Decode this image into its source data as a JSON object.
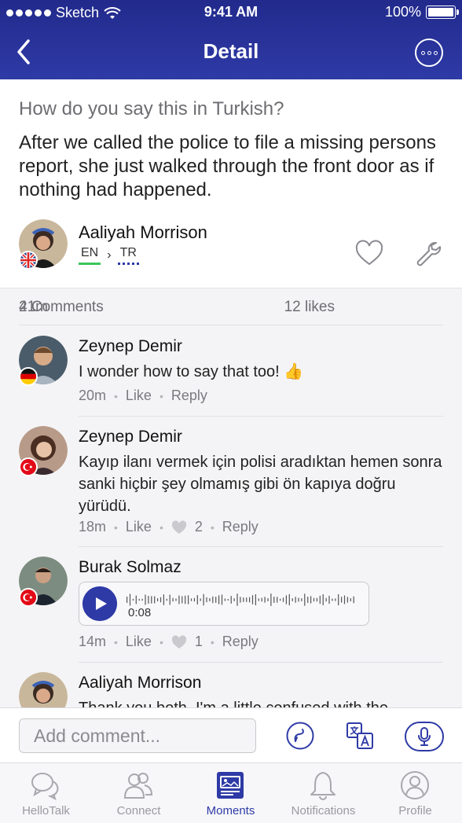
{
  "status_bar": {
    "carrier": "Sketch",
    "time": "9:41 AM",
    "battery": "100%"
  },
  "nav": {
    "title": "Detail"
  },
  "post": {
    "question": "How do you say this in Turkish?",
    "text": "After we called the police to file a missing persons report, she just walked through the front door as if nothing had happened.",
    "author": "Aaliyah Morrison",
    "lang_from": "EN",
    "lang_to": "TR",
    "time": "21m",
    "likes": "12 likes",
    "comments": "4 Comments"
  },
  "comments": [
    {
      "name": "Zeynep Demir",
      "text": "I wonder how to say that too! 👍",
      "time": "20m",
      "like": "Like",
      "reply": "Reply"
    },
    {
      "name": "Zeynep Demir",
      "text": "Kayıp ilanı vermek için polisi aradıktan hemen sonra sanki hiçbir şey olmamış gibi ön kapıya doğru yürüdü.",
      "time": "18m",
      "like": "Like",
      "like_count": "2",
      "reply": "Reply"
    },
    {
      "name": "Burak Solmaz",
      "audio_duration": "0:08",
      "time": "14m",
      "like": "Like",
      "like_count": "1",
      "reply": "Reply"
    },
    {
      "name": "Aaliyah Morrison",
      "text": "Thank you both. I'm a little confused with the"
    }
  ],
  "input": {
    "placeholder": "Add comment..."
  },
  "tabs": [
    {
      "label": "HelloTalk",
      "icon": "chat-bubbles-icon"
    },
    {
      "label": "Connect",
      "icon": "people-icon"
    },
    {
      "label": "Moments",
      "icon": "moments-icon",
      "active": true
    },
    {
      "label": "Notifications",
      "icon": "bell-icon"
    },
    {
      "label": "Profile",
      "icon": "profile-icon"
    }
  ],
  "colors": {
    "brand": "#2e3aa6",
    "header_top": "#222a8c",
    "lang_en_underline": "#3cc55a"
  }
}
